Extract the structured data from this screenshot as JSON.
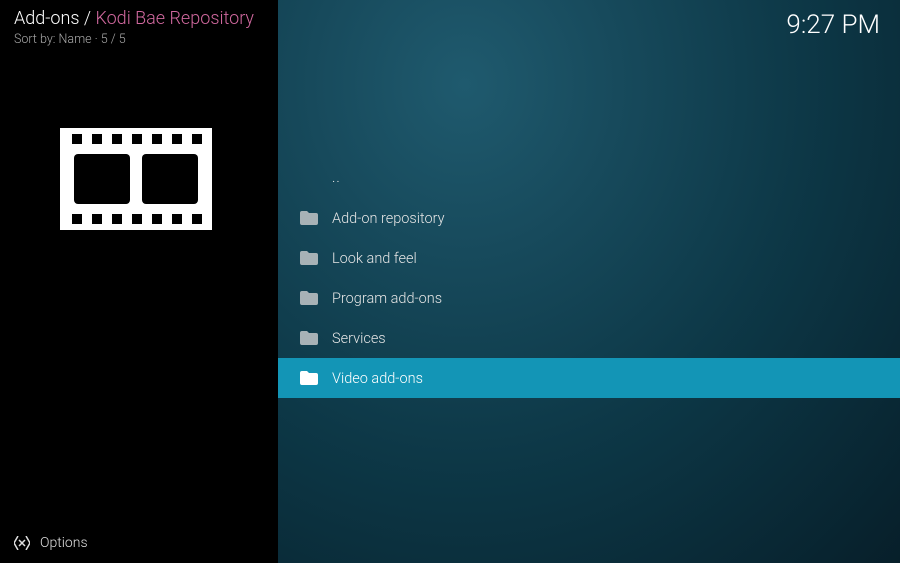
{
  "header": {
    "breadcrumb_section": "Add-ons",
    "breadcrumb_separator": " / ",
    "breadcrumb_current": "Kodi Bae Repository",
    "sort_label": "Sort by: Name  ·  5 / 5",
    "clock": "9:27 PM"
  },
  "list": {
    "parent": "..",
    "items": [
      {
        "label": "Add-on repository",
        "selected": false
      },
      {
        "label": "Look and feel",
        "selected": false
      },
      {
        "label": "Program add-ons",
        "selected": false
      },
      {
        "label": "Services",
        "selected": false
      },
      {
        "label": "Video add-ons",
        "selected": true
      }
    ]
  },
  "footer": {
    "options_label": "Options"
  }
}
